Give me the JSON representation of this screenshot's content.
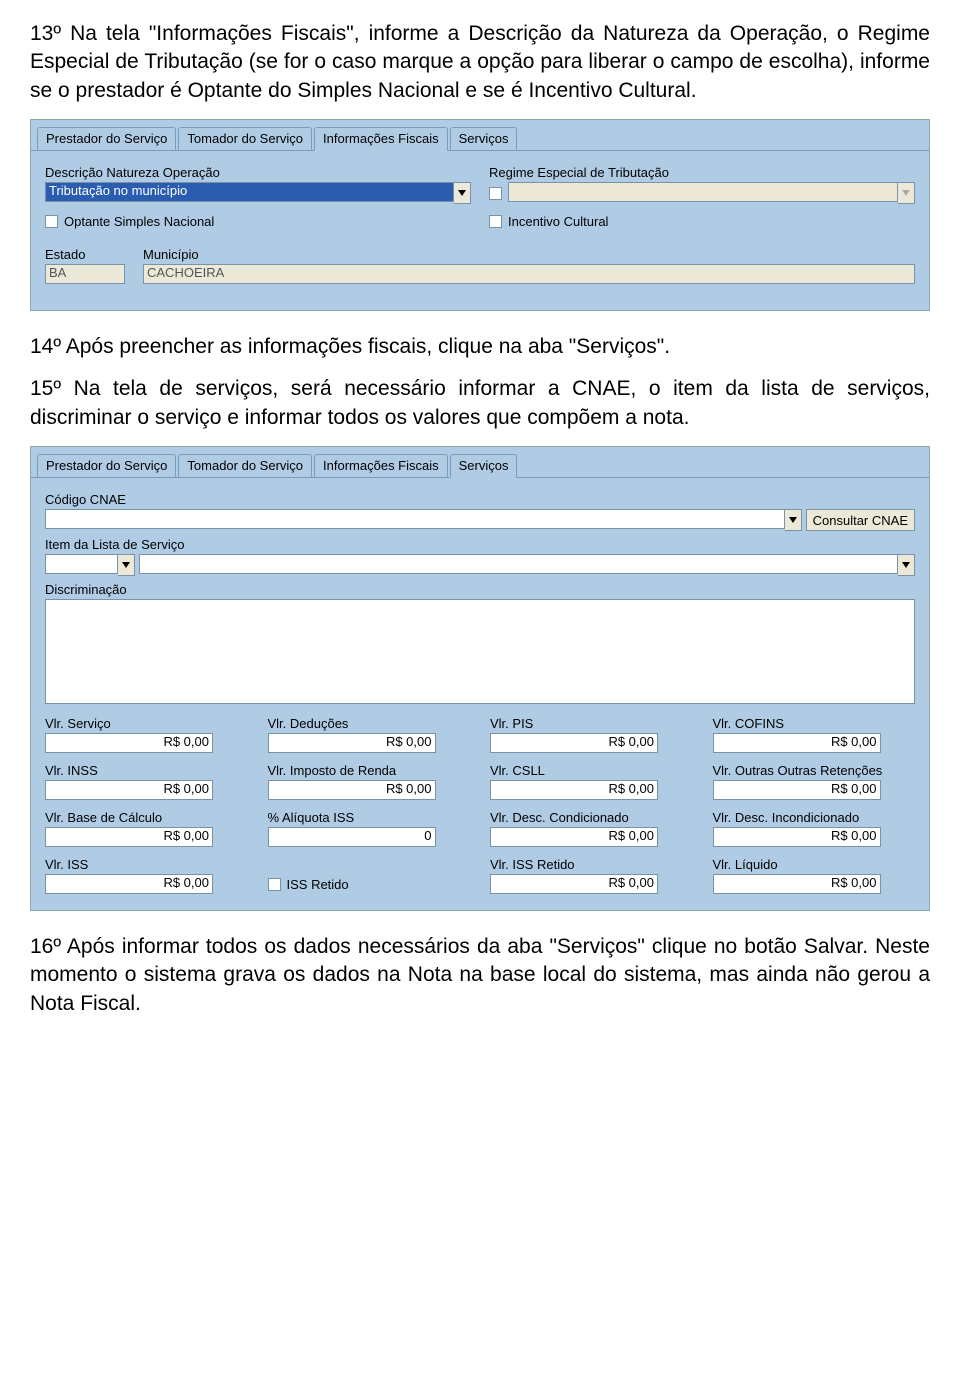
{
  "paragraphs": {
    "p13": "13º Na tela \"Informações Fiscais\", informe a Descrição da Natureza da Operação, o Regime Especial de Tributação (se for o caso marque a opção para liberar o campo de escolha), informe se o prestador é Optante do Simples Nacional e se é Incentivo Cultural.",
    "p14": "14º Após preencher as informações fiscais, clique na aba \"Serviços\".",
    "p15": "15º Na tela de serviços, será necessário informar a CNAE, o item da lista de serviços, discriminar o serviço e informar todos os valores que compõem a nota.",
    "p16": "16º Após informar todos os dados necessários da aba \"Serviços\" clique no botão Salvar. Neste momento o sistema grava os dados na Nota na base local do sistema, mas ainda não gerou a Nota Fiscal."
  },
  "tabs": {
    "prestador": "Prestador do Serviço",
    "tomador": "Tomador do Serviço",
    "fiscais": "Informações Fiscais",
    "servicos": "Serviços"
  },
  "fiscais": {
    "labels": {
      "descricao": "Descrição Natureza Operação",
      "regime": "Regime Especial de Tributação",
      "optante": "Optante Simples Nacional",
      "incentivo": "Incentivo Cultural",
      "estado": "Estado",
      "municipio": "Município"
    },
    "values": {
      "descricao": "Tributação no município",
      "regime": "",
      "estado": "BA",
      "municipio": "CACHOEIRA"
    }
  },
  "servicos": {
    "labels": {
      "codigoCnae": "Código CNAE",
      "consultarCnae": "Consultar CNAE",
      "itemLista": "Item da Lista de Serviço",
      "discriminacao": "Discriminação",
      "vServico": "Vlr. Serviço",
      "vDeducoes": "Vlr. Deduções",
      "vPis": "Vlr. PIS",
      "vCofins": "Vlr. COFINS",
      "vInss": "Vlr. INSS",
      "vIr": "Vlr. Imposto de Renda",
      "vCsll": "Vlr. CSLL",
      "vOutras": "Vlr. Outras Outras Retenções",
      "vBase": "Vlr. Base de Cálculo",
      "aliquota": "% Alíquota ISS",
      "vDescCond": "Vlr. Desc. Condicionado",
      "vDescIncond": "Vlr. Desc. Incondicionado",
      "vIss": "Vlr. ISS",
      "issRetido": "ISS Retido",
      "vIssRetido": "Vlr. ISS Retido",
      "vLiquido": "Vlr. Líquido"
    },
    "values": {
      "money": "R$ 0,00",
      "aliquota": "0"
    }
  }
}
